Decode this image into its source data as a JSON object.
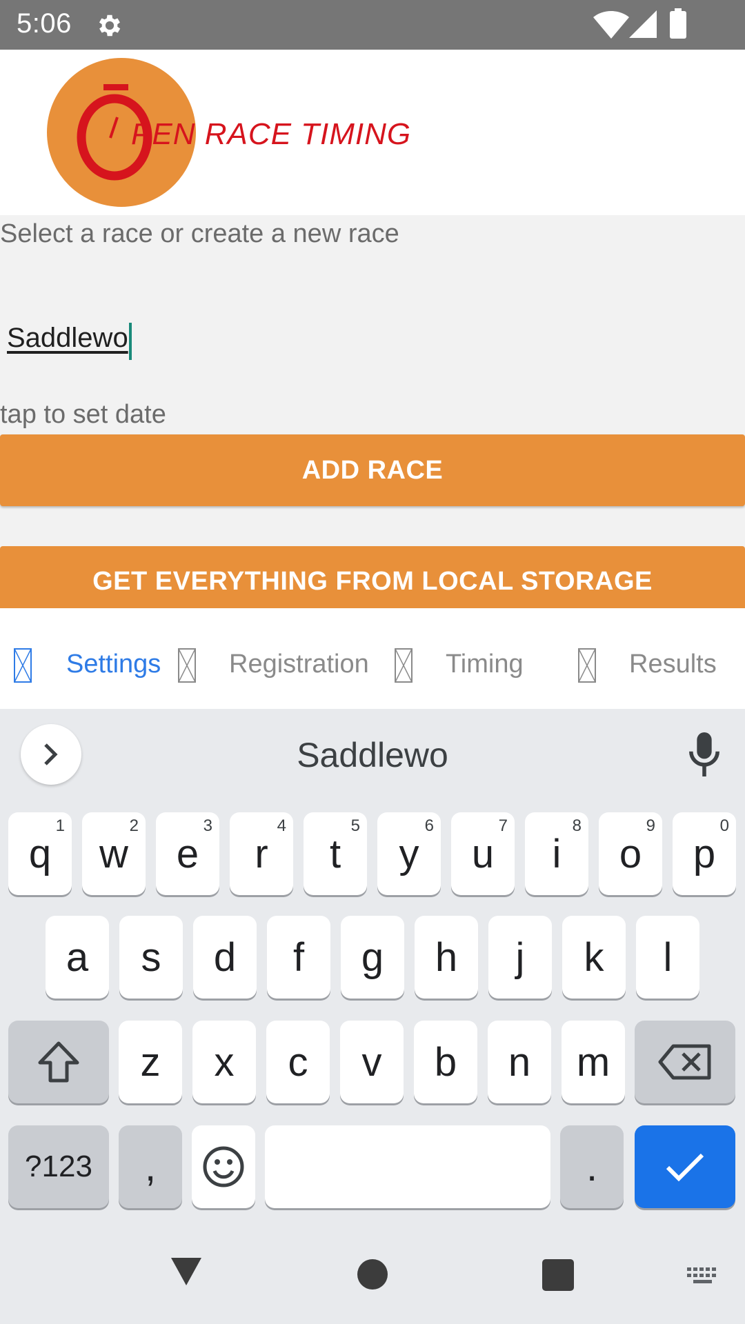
{
  "status_bar": {
    "time": "5:06",
    "icons": [
      "gear-icon",
      "wifi-icon",
      "signal-icon",
      "battery-icon"
    ]
  },
  "header": {
    "logo_text": "PEN RACE TIMING",
    "logo_colors": {
      "circle": "#e8903a",
      "text": "#d6141d"
    }
  },
  "main": {
    "prompt": "Select a race or create a new race",
    "race_name_value": "Saddlewo",
    "date_hint": "tap to set date",
    "add_race_label": "ADD RACE",
    "local_storage_label": "GET EVERYTHING FROM LOCAL STORAGE",
    "accent_color": "#e8903a"
  },
  "tabs": [
    {
      "label": "Settings",
      "active": true
    },
    {
      "label": "Registration",
      "active": false
    },
    {
      "label": "Timing",
      "active": false
    },
    {
      "label": "Results",
      "active": false
    }
  ],
  "keyboard": {
    "suggestion": "Saddlewo",
    "row1": [
      {
        "key": "q",
        "hint": "1"
      },
      {
        "key": "w",
        "hint": "2"
      },
      {
        "key": "e",
        "hint": "3"
      },
      {
        "key": "r",
        "hint": "4"
      },
      {
        "key": "t",
        "hint": "5"
      },
      {
        "key": "y",
        "hint": "6"
      },
      {
        "key": "u",
        "hint": "7"
      },
      {
        "key": "i",
        "hint": "8"
      },
      {
        "key": "o",
        "hint": "9"
      },
      {
        "key": "p",
        "hint": "0"
      }
    ],
    "row2": [
      "a",
      "s",
      "d",
      "f",
      "g",
      "h",
      "j",
      "k",
      "l"
    ],
    "row3": [
      "z",
      "x",
      "c",
      "v",
      "b",
      "n",
      "m"
    ],
    "symbols_label": "?123",
    "comma": ",",
    "period": ".",
    "enter_color": "#1a73e8"
  }
}
